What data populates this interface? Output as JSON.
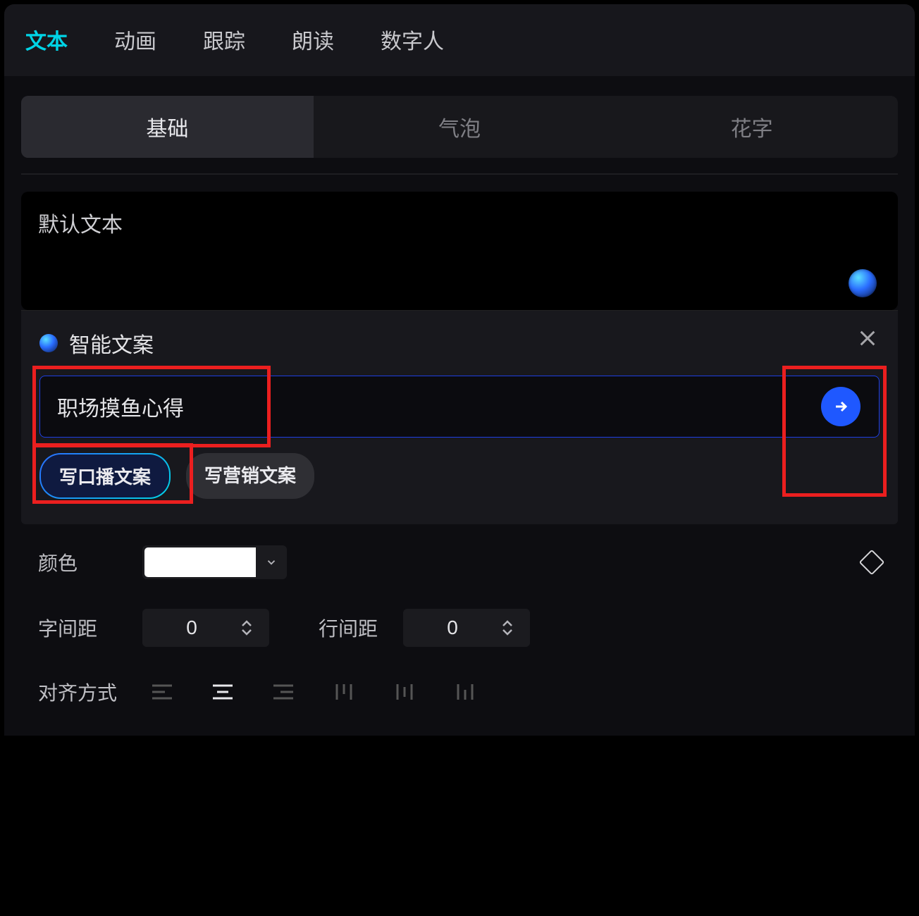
{
  "topTabs": {
    "items": [
      "文本",
      "动画",
      "跟踪",
      "朗读",
      "数字人"
    ],
    "activeIndex": 0
  },
  "subTabs": {
    "items": [
      "基础",
      "气泡",
      "花字"
    ],
    "activeIndex": 0
  },
  "textCard": {
    "text": "默认文本"
  },
  "smartPopup": {
    "title": "智能文案",
    "inputValue": "职场摸鱼心得",
    "chips": [
      "写口播文案",
      "写营销文案"
    ],
    "activeChip": 0
  },
  "options": {
    "colorLabel": "颜色",
    "colorValue": "#ffffff",
    "letterSpacingLabel": "字间距",
    "letterSpacingValue": "0",
    "lineSpacingLabel": "行间距",
    "lineSpacingValue": "0",
    "alignLabel": "对齐方式"
  }
}
